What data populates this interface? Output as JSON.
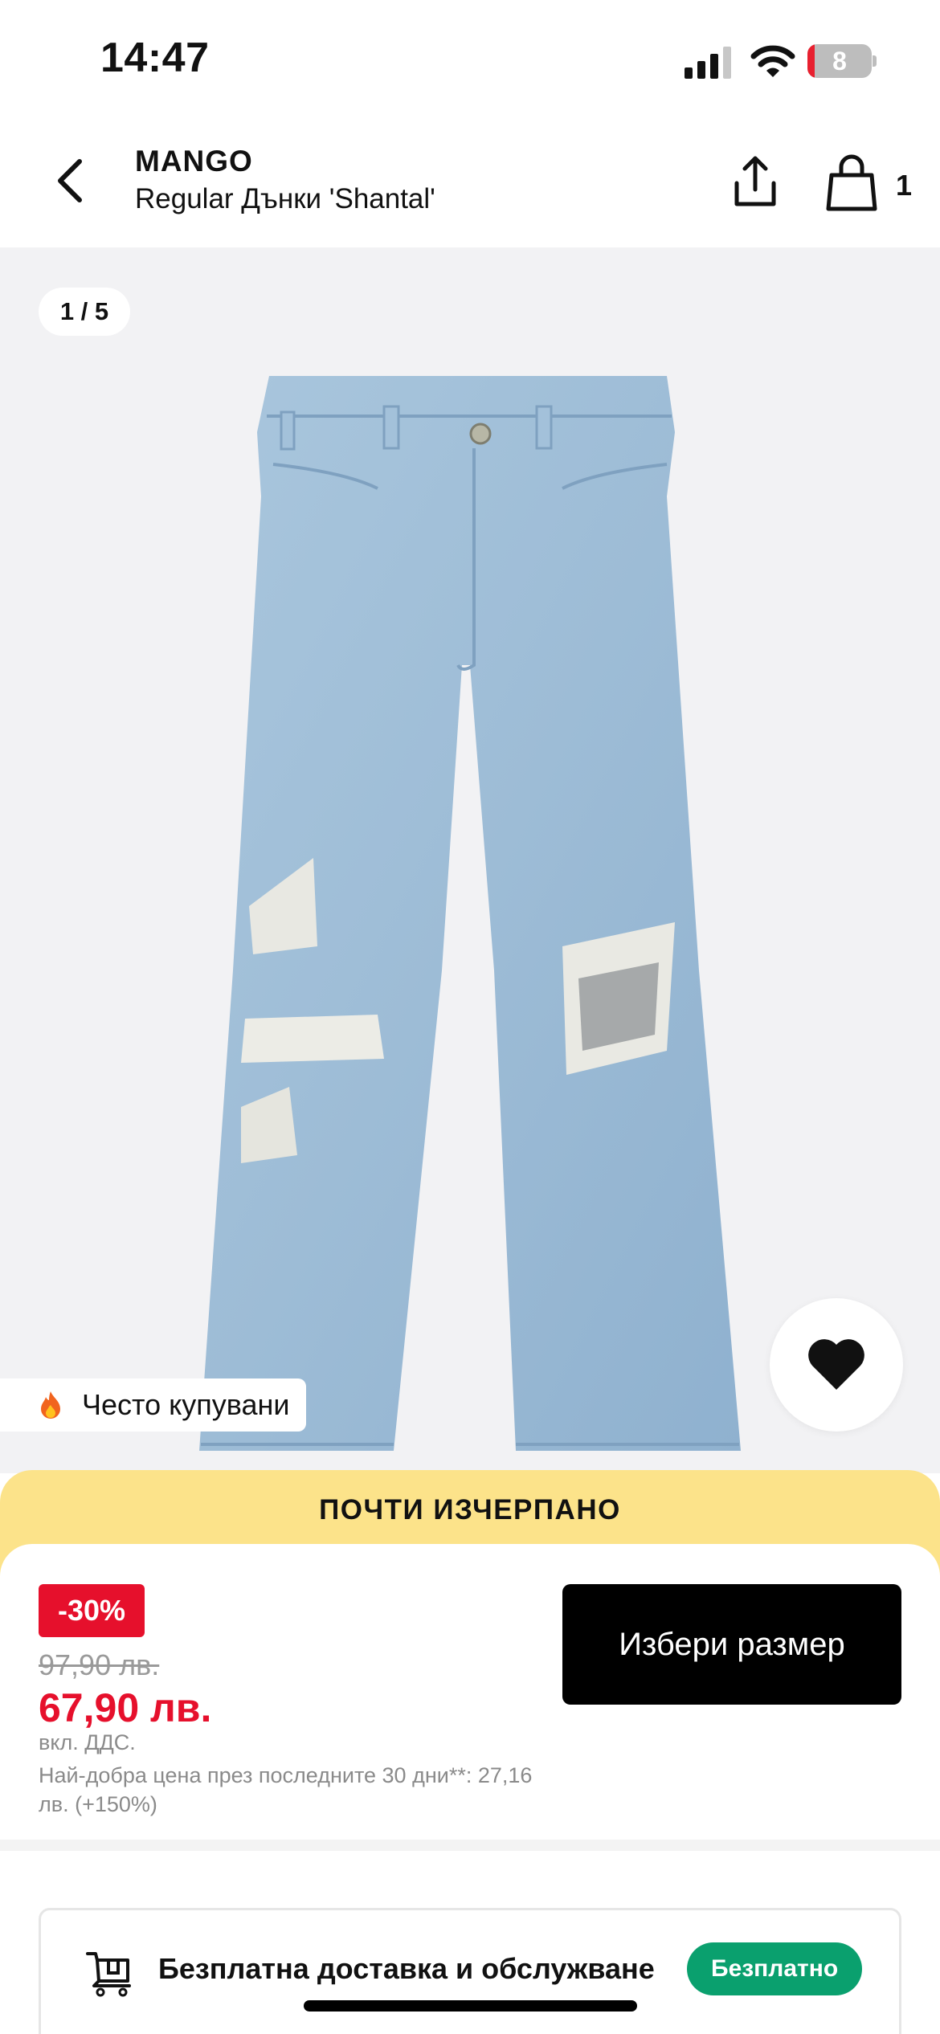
{
  "status_bar": {
    "time": "14:47",
    "battery_level": "8",
    "icons": [
      "signal-icon",
      "wifi-icon",
      "battery-icon"
    ]
  },
  "header": {
    "brand": "MANGO",
    "product_title": "Regular Дънки 'Shantal'",
    "cart_count": "1",
    "icons": [
      "back-arrow-icon",
      "share-icon",
      "shopping-bag-icon"
    ]
  },
  "gallery": {
    "image_counter": "1 / 5",
    "popular_badge": "Често купувани",
    "icons": [
      "fire-icon",
      "heart-icon"
    ]
  },
  "stock_banner": {
    "text": "ПОЧТИ ИЗЧЕРПАНО",
    "color": "#fce38a"
  },
  "pricing": {
    "discount": "-30%",
    "old_price": "97,90 лв.",
    "new_price": "67,90 лв.",
    "vat_note": "вкл. ДДС.",
    "best_price_note": "Най-добра цена през последните 30 дни**: 27,16 лв. (+150%)",
    "accent_color": "#e6102c"
  },
  "actions": {
    "select_size_label": "Избери размер"
  },
  "delivery": {
    "label": "Безплатна доставка и обслужване",
    "badge": "Безплатно",
    "badge_color": "#0aa06e",
    "icon": "delivery-cart-icon"
  }
}
